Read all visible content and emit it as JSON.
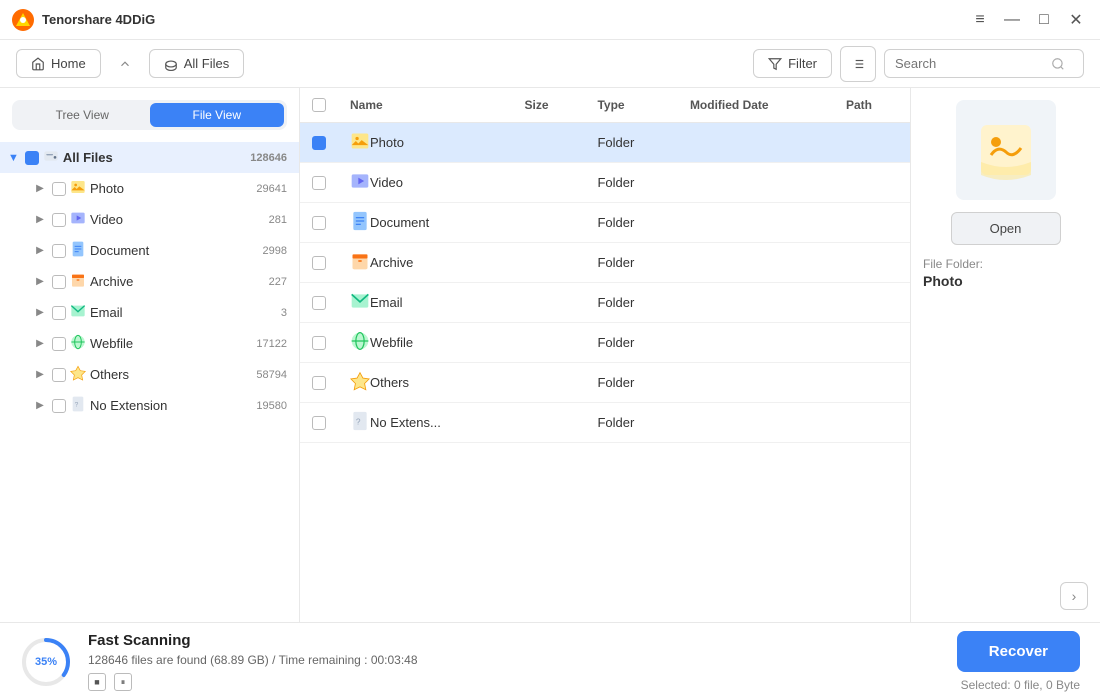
{
  "app": {
    "title": "Tenorshare 4DDiG",
    "logo_char": "🔶"
  },
  "titlebar": {
    "controls": {
      "menu": "≡",
      "minimize": "—",
      "maximize": "□",
      "close": "✕"
    }
  },
  "toolbar": {
    "home_label": "Home",
    "all_files_label": "All Files",
    "filter_label": "Filter",
    "search_placeholder": "Search"
  },
  "sidebar": {
    "view_tree": "Tree View",
    "view_file": "File View",
    "items": [
      {
        "id": "all-files",
        "label": "All Files",
        "count": "128646",
        "icon": "hdd",
        "indent": 0,
        "root": true,
        "expanded": true
      },
      {
        "id": "photo",
        "label": "Photo",
        "count": "29641",
        "icon": "photo",
        "indent": 1
      },
      {
        "id": "video",
        "label": "Video",
        "count": "281",
        "icon": "video",
        "indent": 1
      },
      {
        "id": "document",
        "label": "Document",
        "count": "2998",
        "icon": "document",
        "indent": 1
      },
      {
        "id": "archive",
        "label": "Archive",
        "count": "227",
        "icon": "archive",
        "indent": 1
      },
      {
        "id": "email",
        "label": "Email",
        "count": "3",
        "icon": "email",
        "indent": 1
      },
      {
        "id": "webfile",
        "label": "Webfile",
        "count": "17122",
        "icon": "webfile",
        "indent": 1
      },
      {
        "id": "others",
        "label": "Others",
        "count": "58794",
        "icon": "others",
        "indent": 1
      },
      {
        "id": "noext",
        "label": "No Extension",
        "count": "19580",
        "icon": "noext",
        "indent": 1
      }
    ]
  },
  "table": {
    "columns": [
      "Name",
      "Size",
      "Type",
      "Modified Date",
      "Path"
    ],
    "rows": [
      {
        "name": "Photo",
        "size": "",
        "type": "Folder",
        "modified": "",
        "path": "",
        "icon": "photo",
        "selected": true
      },
      {
        "name": "Video",
        "size": "",
        "type": "Folder",
        "modified": "",
        "path": "",
        "icon": "video",
        "selected": false
      },
      {
        "name": "Document",
        "size": "",
        "type": "Folder",
        "modified": "",
        "path": "",
        "icon": "document",
        "selected": false
      },
      {
        "name": "Archive",
        "size": "",
        "type": "Folder",
        "modified": "",
        "path": "",
        "icon": "archive",
        "selected": false
      },
      {
        "name": "Email",
        "size": "",
        "type": "Folder",
        "modified": "",
        "path": "",
        "icon": "email",
        "selected": false
      },
      {
        "name": "Webfile",
        "size": "",
        "type": "Folder",
        "modified": "",
        "path": "",
        "icon": "webfile",
        "selected": false
      },
      {
        "name": "Others",
        "size": "",
        "type": "Folder",
        "modified": "",
        "path": "",
        "icon": "others",
        "selected": false
      },
      {
        "name": "No Extens...",
        "size": "",
        "type": "Folder",
        "modified": "",
        "path": "",
        "icon": "noext",
        "selected": false
      }
    ]
  },
  "preview": {
    "open_btn": "Open",
    "file_folder_label": "File Folder:",
    "folder_name": "Photo",
    "chevron": "›"
  },
  "bottom": {
    "progress_pct": 35,
    "scan_title": "Fast Scanning",
    "scan_detail": "128646 files are found (68.89 GB)  /  Time remaining : 00:03:48",
    "recover_btn": "Recover",
    "selected_info": "Selected: 0 file, 0 Byte",
    "stop_icon": "■",
    "pause_icon": "⏸"
  }
}
